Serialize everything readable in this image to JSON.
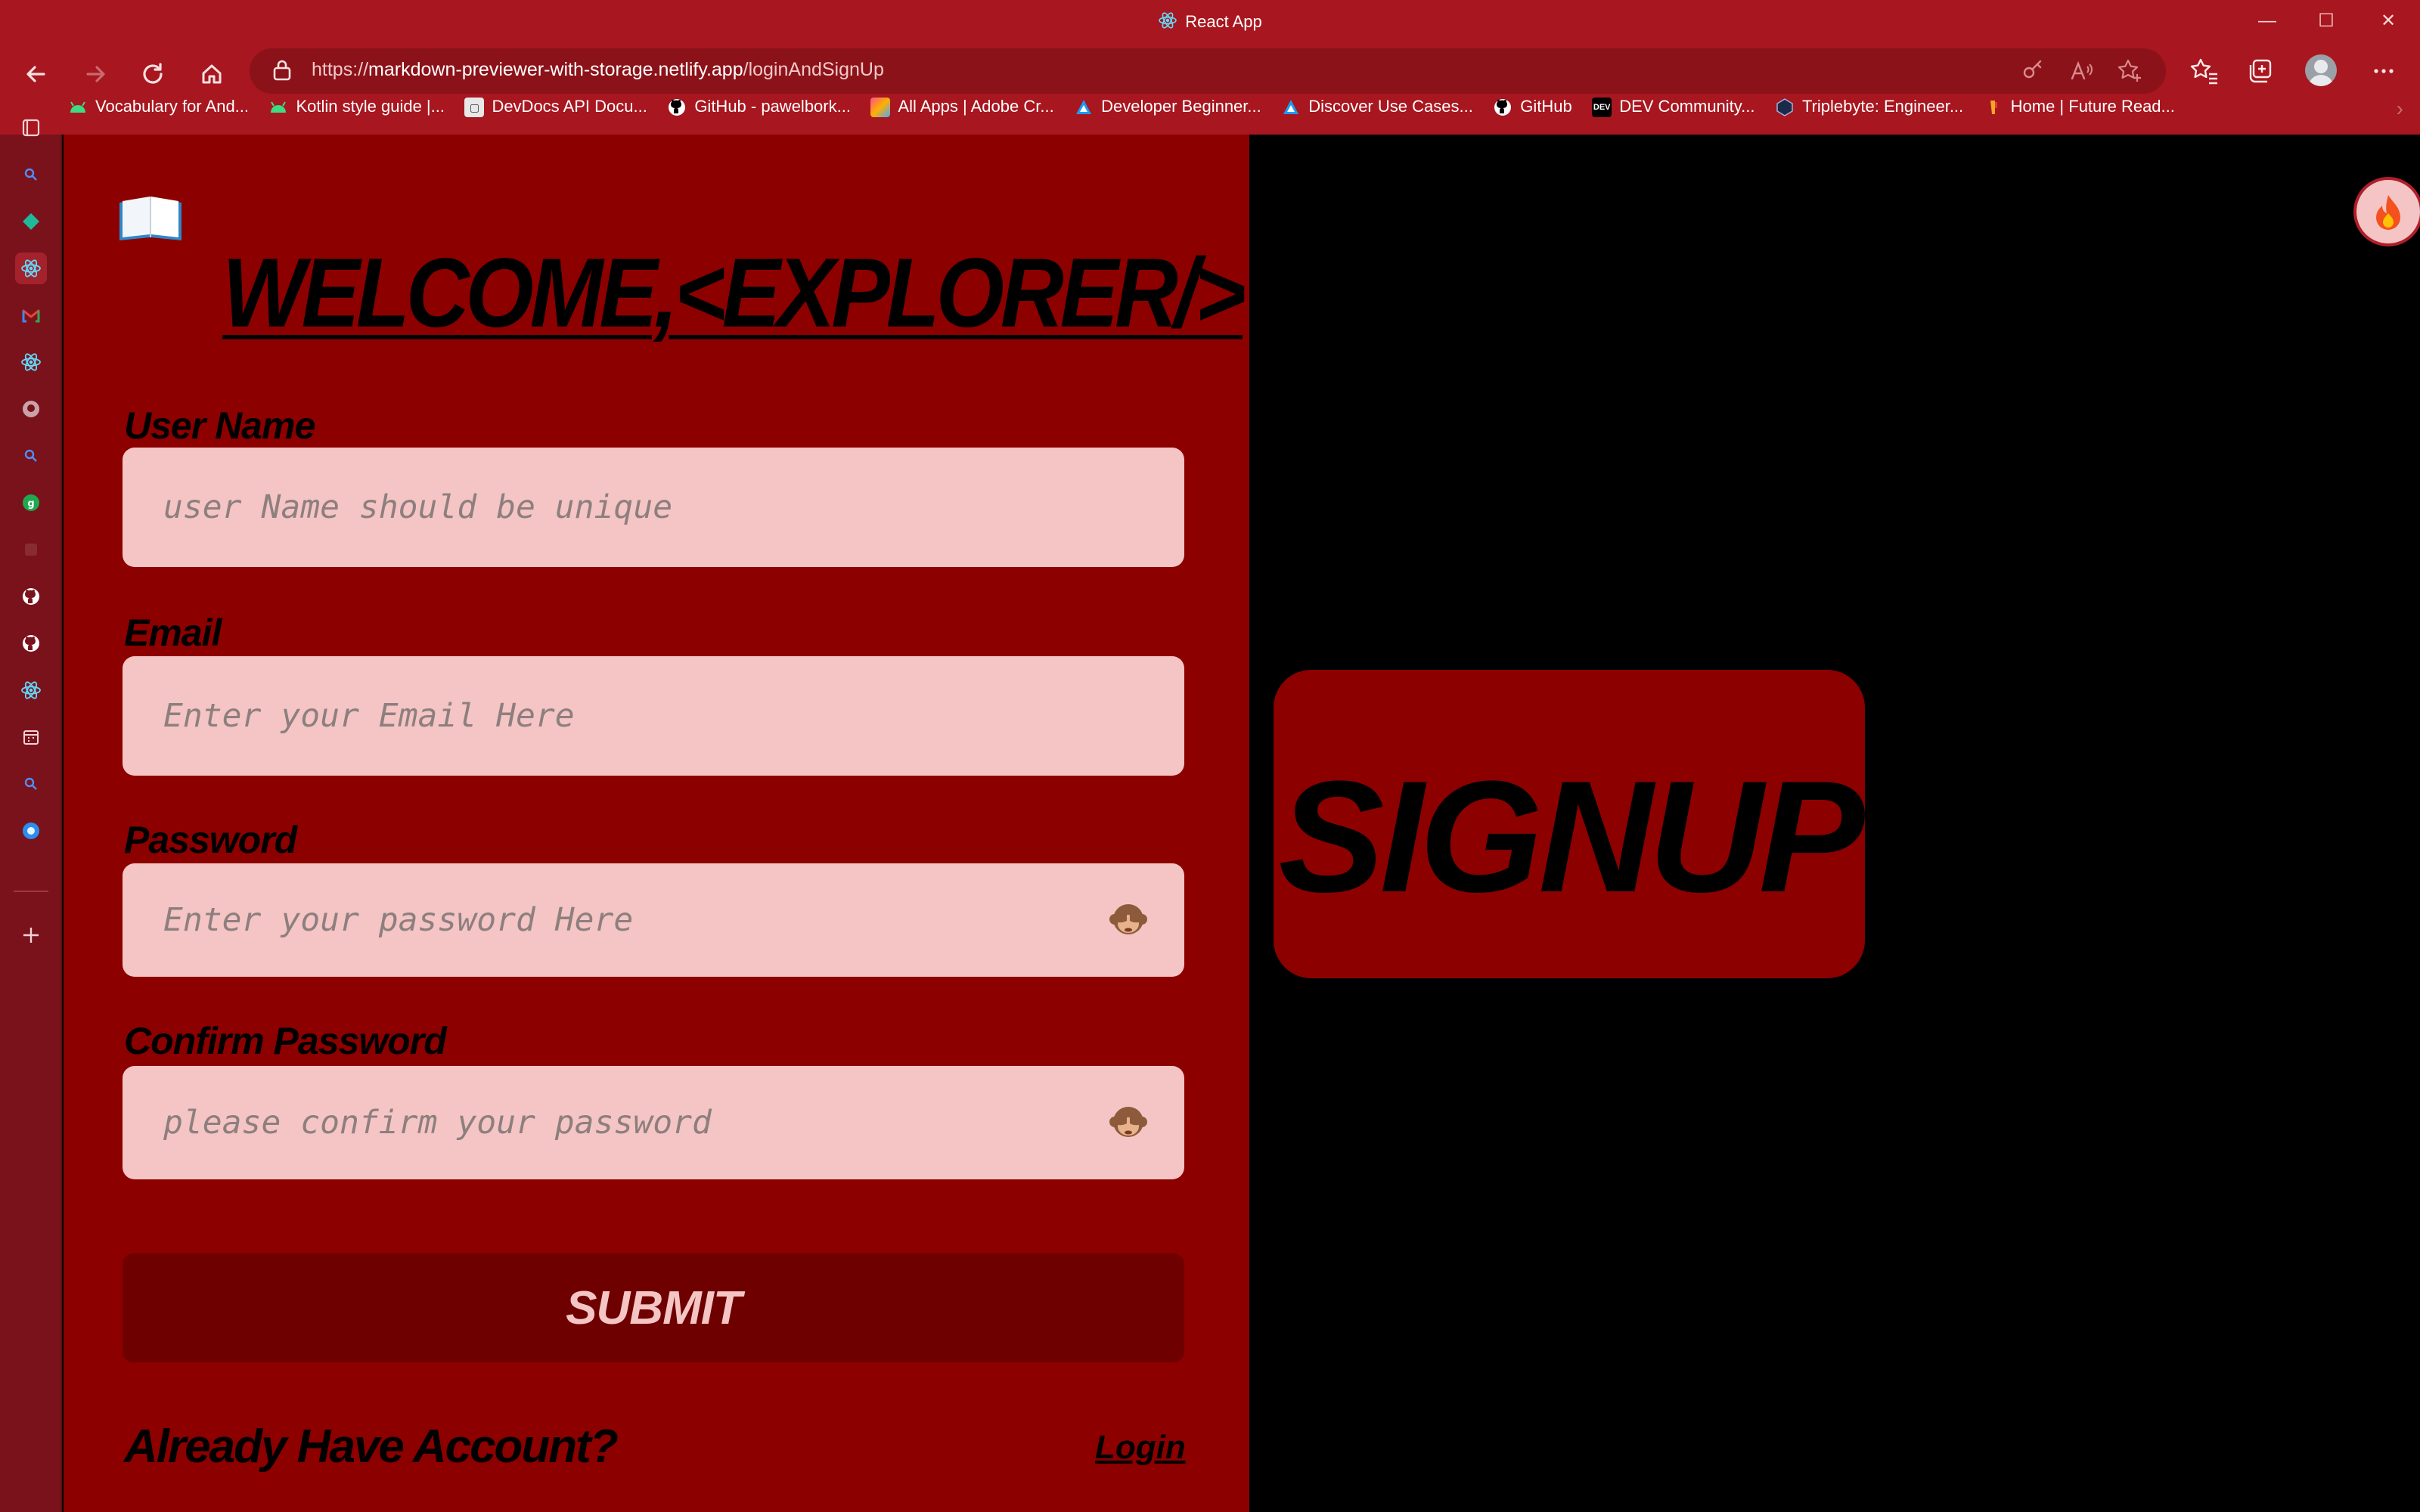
{
  "browser": {
    "tab_title": "React App",
    "window_controls": {
      "minimize": "—",
      "maximize": "☐",
      "close": "✕"
    },
    "url": {
      "scheme": "https://",
      "host": "markdown-previewer-with-storage.netlify.app",
      "path": "/loginAndSignUp"
    },
    "theme_color": "#a8161f",
    "bookmarks": [
      {
        "label": "Vocabulary for And...",
        "icon": "android-icon",
        "color": "#3ddc84"
      },
      {
        "label": "Kotlin style guide |...",
        "icon": "android-icon",
        "color": "#3ddc84"
      },
      {
        "label": "DevDocs API Docu...",
        "icon": "devdocs-icon",
        "color": "#e8e8e8"
      },
      {
        "label": "GitHub - pawelbork...",
        "icon": "github-icon",
        "color": "#ffffff"
      },
      {
        "label": "All Apps | Adobe Cr...",
        "icon": "adobe-cc-icon",
        "color": "#da1f26"
      },
      {
        "label": "Developer Beginner...",
        "icon": "azure-icon",
        "color": "#1d9bf0"
      },
      {
        "label": "Discover Use Cases...",
        "icon": "azure-icon",
        "color": "#1d9bf0"
      },
      {
        "label": "GitHub",
        "icon": "github-icon",
        "color": "#ffffff"
      },
      {
        "label": "DEV Community...",
        "icon": "dev-icon",
        "color": "#000000"
      },
      {
        "label": "Triplebyte: Engineer...",
        "icon": "triplebyte-icon",
        "color": "#1b2a4a"
      },
      {
        "label": "Home | Future Read...",
        "icon": "future-read-icon",
        "color": "#f5a623"
      }
    ]
  },
  "page": {
    "heading": "WELCOME,<EXPLORER/>",
    "fields": {
      "username": {
        "label": "User Name",
        "placeholder": "user Name should be unique"
      },
      "email": {
        "label": "Email",
        "placeholder": "Enter your Email Here"
      },
      "password": {
        "label": "Password",
        "placeholder": "Enter your password Here"
      },
      "confirm": {
        "label": "Confirm Password",
        "placeholder": "please confirm your password"
      }
    },
    "submit_label": "SUBMIT",
    "already_text": "Already Have Account?",
    "login_label": "Login",
    "signup_banner": "SIGNUP",
    "colors": {
      "panel": "#8c0000",
      "input_bg": "#f4c5c4",
      "button": "#6e0000",
      "right_bg": "#000000"
    }
  }
}
